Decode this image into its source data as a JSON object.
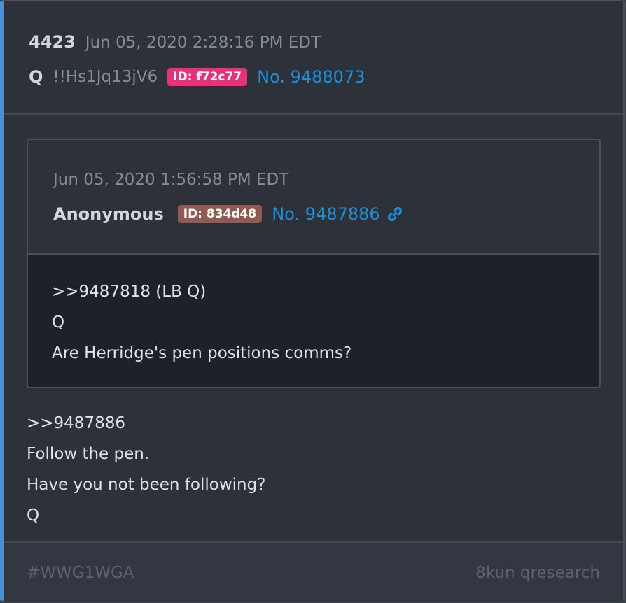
{
  "post": {
    "index": "4423",
    "timestamp": "Jun 05, 2020 2:28:16 PM EDT",
    "author": "Q",
    "tripcode": "!!Hs1Jq13jV6",
    "id_badge": "ID: f72c77",
    "post_number": "No. 9488073",
    "body_lines": [
      ">>9487886",
      "Follow the pen.",
      "Have you not been following?",
      "Q"
    ]
  },
  "quoted_post": {
    "timestamp": "Jun 05, 2020 1:56:58 PM EDT",
    "author": "Anonymous",
    "id_badge": "ID: 834d48",
    "post_number": "No. 9487886",
    "body_lines": [
      ">>9487818 (LB Q)",
      "Q",
      "Are Herridge's pen positions comms?"
    ]
  },
  "footer": {
    "hashtag": "#WWG1WGA",
    "source": "8kun qresearch"
  },
  "colors": {
    "q_id_badge": "#e8317a",
    "anon_id_badge": "#8e5a52",
    "link": "#1e8fd6",
    "accent_border": "#4a90d9"
  },
  "icons": {
    "post_link": "link-icon"
  }
}
